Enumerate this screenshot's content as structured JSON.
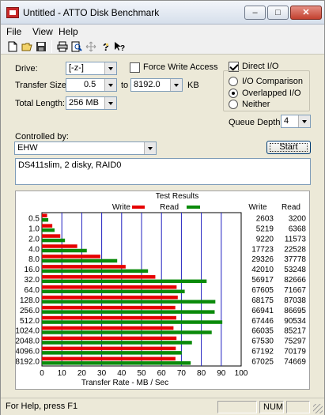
{
  "window": {
    "title": "Untitled - ATTO Disk Benchmark",
    "minimize_label": "–",
    "maximize_label": "□",
    "close_label": "✕"
  },
  "menu": {
    "items": [
      "File",
      "View",
      "Help"
    ]
  },
  "toolbar": {
    "icons": [
      "new-file-icon",
      "open-folder-icon",
      "save-icon",
      "print-icon",
      "print-preview-icon",
      "move-icon",
      "help-icon",
      "context-help-icon"
    ]
  },
  "form": {
    "drive_label": "Drive:",
    "drive_value": "[-z-]",
    "force_write_label": "Force Write Access",
    "force_write_checked": false,
    "transfer_size_label": "Transfer Size:",
    "transfer_from": "0.5",
    "to_label": "to",
    "transfer_to": "8192.0",
    "kb_label": "KB",
    "total_length_label": "Total Length:",
    "total_length_value": "256 MB",
    "direct_io_label": "Direct I/O",
    "direct_io_checked": true,
    "io_modes": [
      {
        "label": "I/O Comparison",
        "checked": false
      },
      {
        "label": "Overlapped I/O",
        "checked": true
      },
      {
        "label": "Neither",
        "checked": false
      }
    ],
    "queue_depth_label": "Queue Depth:",
    "queue_depth_value": "4",
    "controlled_by_label": "Controlled by:",
    "controlled_by_value": "EHW",
    "start_label": "Start",
    "description": "DS411slim, 2 disky, RAID0"
  },
  "results": {
    "group_label": "Test Results",
    "write_col_label": "Write",
    "read_col_label": "Read",
    "legend_write": "Write",
    "legend_read": "Read",
    "write_color": "#e60000",
    "read_color": "#0a8a0a",
    "grid_color": "#2020c0"
  },
  "chart_data": {
    "type": "bar",
    "orientation": "horizontal",
    "xlabel": "Transfer Rate - MB / Sec",
    "xlim": [
      0,
      100
    ],
    "xticks": [
      "0",
      "10",
      "20",
      "30",
      "40",
      "50",
      "60",
      "70",
      "80",
      "90",
      "100"
    ],
    "categories": [
      "0.5",
      "1.0",
      "2.0",
      "4.0",
      "8.0",
      "16.0",
      "32.0",
      "64.0",
      "128.0",
      "256.0",
      "512.0",
      "1024.0",
      "2048.0",
      "4096.0",
      "8192.0"
    ],
    "series": [
      {
        "name": "Write",
        "values": [
          2.603,
          5.219,
          9.22,
          17.723,
          29.326,
          42.01,
          56.917,
          67.605,
          68.175,
          66.941,
          67.446,
          66.035,
          67.53,
          67.192,
          67.025
        ],
        "kb_values": [
          "2603",
          "5219",
          "9220",
          "17723",
          "29326",
          "42010",
          "56917",
          "67605",
          "68175",
          "66941",
          "67446",
          "66035",
          "67530",
          "67192",
          "67025"
        ]
      },
      {
        "name": "Read",
        "values": [
          3.2,
          6.368,
          11.573,
          22.528,
          37.778,
          53.248,
          82.666,
          71.667,
          87.038,
          86.695,
          90.534,
          85.217,
          75.297,
          70.179,
          74.669
        ],
        "kb_values": [
          "3200",
          "6368",
          "11573",
          "22528",
          "37778",
          "53248",
          "82666",
          "71667",
          "87038",
          "86695",
          "90534",
          "85217",
          "75297",
          "70179",
          "74669"
        ]
      }
    ]
  },
  "status": {
    "help_text": "For Help, press F1",
    "num_label": "NUM"
  }
}
